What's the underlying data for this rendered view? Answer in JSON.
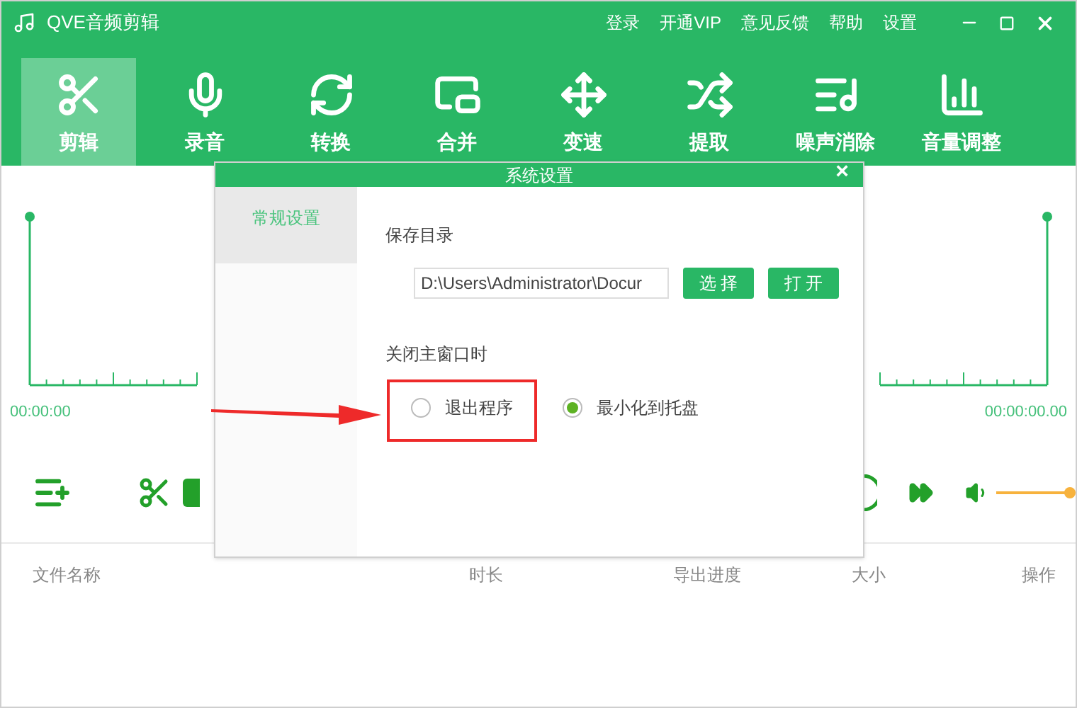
{
  "window": {
    "title": "QVE音频剪辑"
  },
  "top_links": [
    "登录",
    "开通VIP",
    "意见反馈",
    "帮助",
    "设置"
  ],
  "tabs": [
    {
      "kind": "scissors",
      "label": "剪辑",
      "selected": true
    },
    {
      "kind": "mic",
      "label": "录音",
      "selected": false
    },
    {
      "kind": "convert",
      "label": "转换",
      "selected": false
    },
    {
      "kind": "merge",
      "label": "合并",
      "selected": false
    },
    {
      "kind": "speed",
      "label": "变速",
      "selected": false
    },
    {
      "kind": "shuffle",
      "label": "提取",
      "selected": false
    },
    {
      "kind": "noise",
      "label": "噪声消除",
      "selected": false
    },
    {
      "kind": "bars",
      "label": "音量调整",
      "selected": false
    }
  ],
  "waveform": {
    "start_time": "00:00:00",
    "end_time": "00:00:00.00"
  },
  "volume": {
    "level": 1
  },
  "table": {
    "columns": [
      "文件名称",
      "时长",
      "导出进度",
      "大小",
      "操作"
    ]
  },
  "dialog": {
    "title": "系统设置",
    "close": "×",
    "sidebar": [
      {
        "label": "常规设置",
        "selected": true
      }
    ],
    "save_dir_label": "保存目录",
    "save_dir_value": "D:\\Users\\Administrator\\Docur",
    "buttons": [
      "选 择",
      "打 开"
    ],
    "close_label": "关闭主窗口时",
    "options": [
      {
        "label": "退出程序",
        "selected": false
      },
      {
        "label": "最小化到托盘",
        "selected": true
      }
    ]
  }
}
